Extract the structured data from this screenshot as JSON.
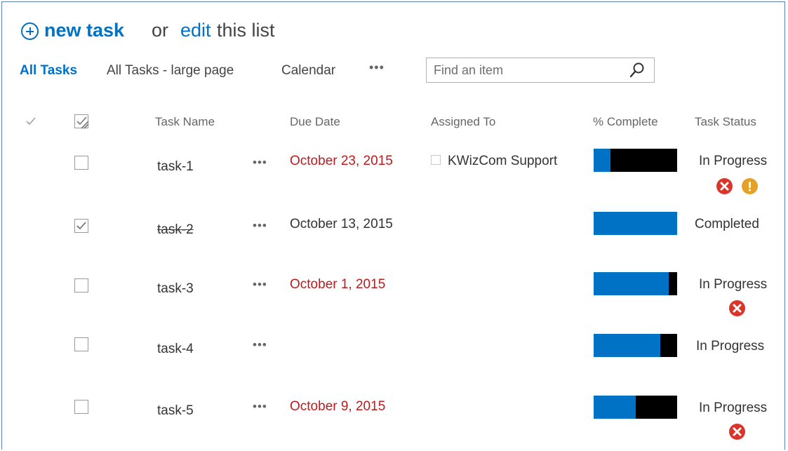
{
  "header": {
    "new_task": "new task",
    "or": "or",
    "edit": "edit",
    "this_list": "this list"
  },
  "views": {
    "items": [
      {
        "label": "All Tasks",
        "active": true
      },
      {
        "label": "All Tasks - large page",
        "active": false
      },
      {
        "label": "Calendar",
        "active": false
      }
    ],
    "more": "•••"
  },
  "search": {
    "placeholder": "Find an item",
    "value": ""
  },
  "columns": {
    "task_name": "Task Name",
    "due_date": "Due Date",
    "assigned_to": "Assigned To",
    "percent_complete": "% Complete",
    "task_status": "Task Status"
  },
  "rows": [
    {
      "name": "task-1",
      "dots": "•••",
      "due": "October 23, 2015",
      "overdue": true,
      "assigned": "KWizCom Support",
      "percent": 20,
      "status": "In Progress",
      "checked": false,
      "icons": [
        "error-icon",
        "warning-icon"
      ]
    },
    {
      "name": "task-2",
      "dots": "•••",
      "due": "October 13, 2015",
      "overdue": false,
      "assigned": "",
      "percent": 100,
      "status": "Completed",
      "checked": true,
      "icons": []
    },
    {
      "name": "task-3",
      "dots": "•••",
      "due": "October 1, 2015",
      "overdue": true,
      "assigned": "",
      "percent": 90,
      "status": "In Progress",
      "checked": false,
      "icons": [
        "error-icon"
      ]
    },
    {
      "name": "task-4",
      "dots": "•••",
      "due": "",
      "overdue": false,
      "assigned": "",
      "percent": 80,
      "status": "In Progress",
      "checked": false,
      "icons": []
    },
    {
      "name": "task-5",
      "dots": "•••",
      "due": "October 9, 2015",
      "overdue": true,
      "assigned": "",
      "percent": 50,
      "status": "In Progress",
      "checked": false,
      "icons": [
        "error-icon"
      ]
    }
  ],
  "colors": {
    "accent": "#0072c6",
    "overdue": "#c0191b",
    "progress_fill": "#0072c6",
    "progress_track": "#000000",
    "error": "#d9352b",
    "warning": "#e5a028"
  }
}
